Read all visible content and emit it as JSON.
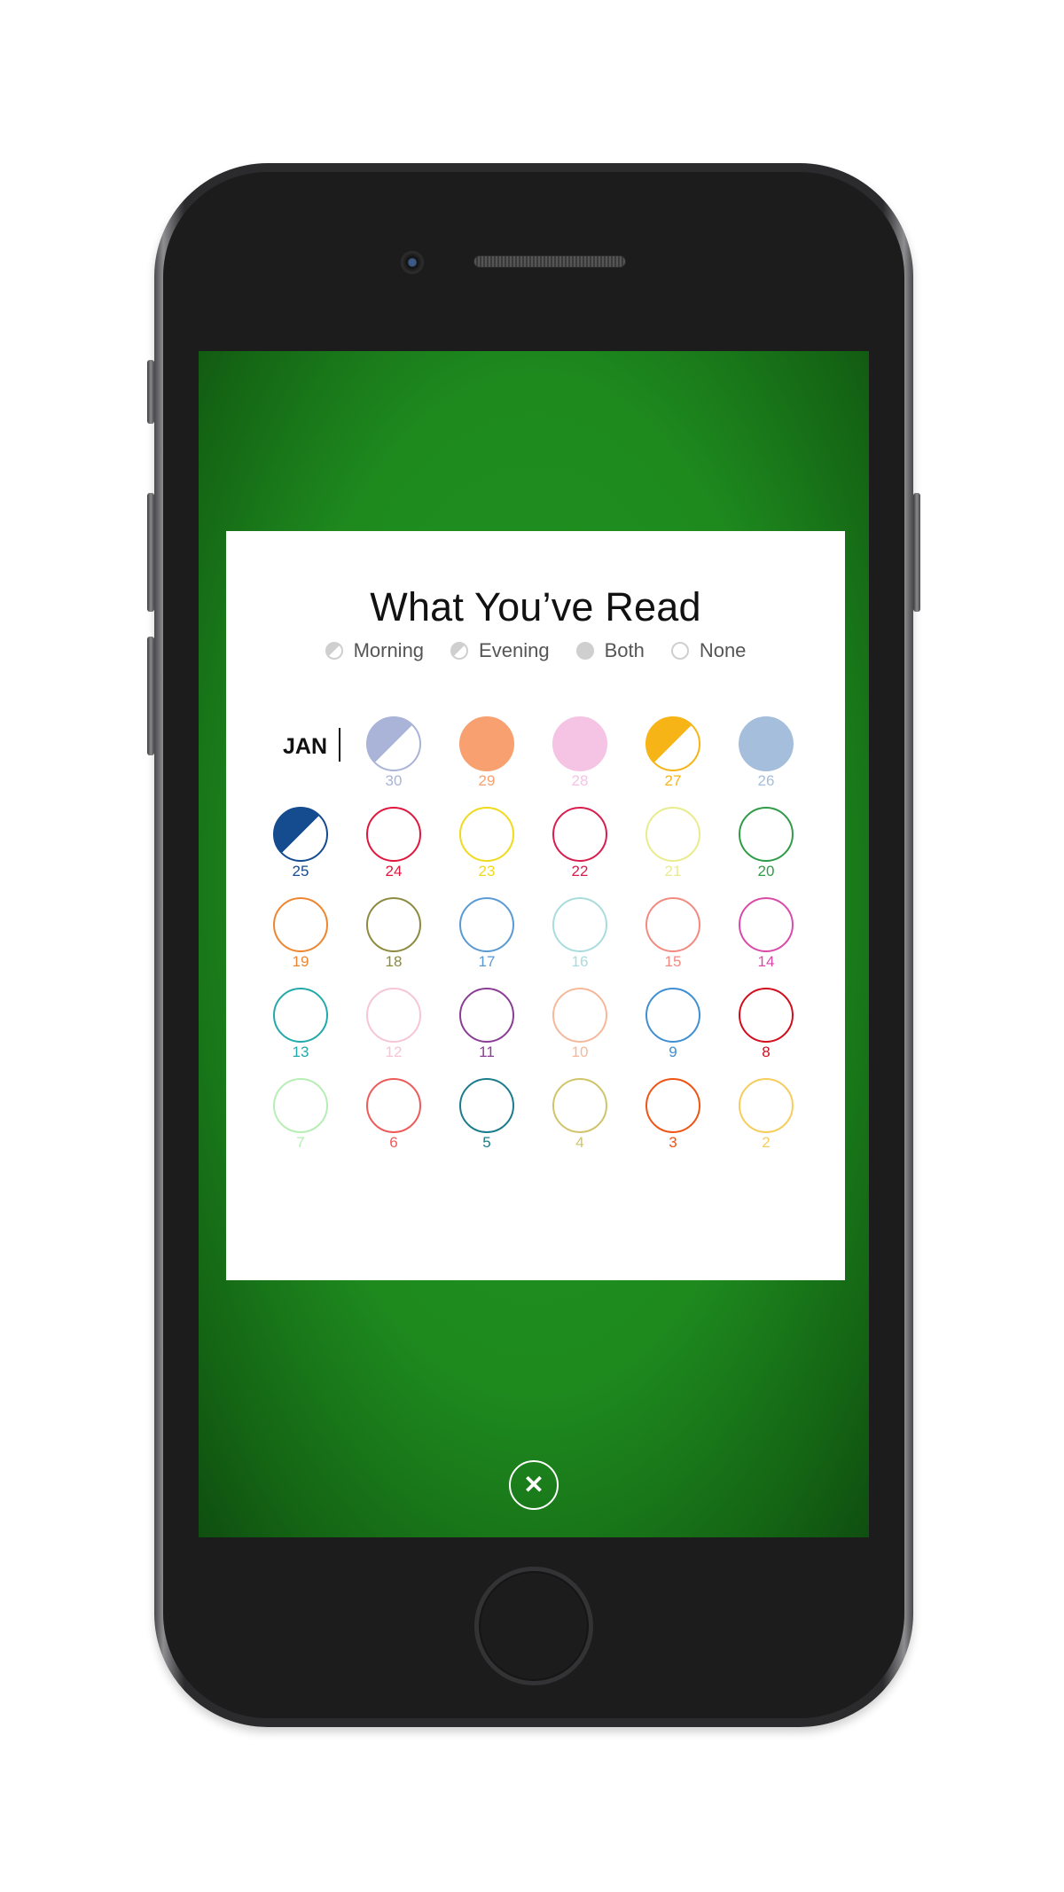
{
  "card": {
    "title": "What You’ve Read",
    "legend": [
      {
        "label": "Morning",
        "icon": "morning-half-icon"
      },
      {
        "label": "Evening",
        "icon": "evening-half-icon"
      },
      {
        "label": "Both",
        "icon": "both-filled-icon"
      },
      {
        "label": "None",
        "icon": "none-empty-icon"
      }
    ],
    "month": "JAN",
    "days": [
      {
        "num": "30",
        "color": "#aab3d8",
        "read": "morning"
      },
      {
        "num": "29",
        "color": "#f8a070",
        "read": "both"
      },
      {
        "num": "28",
        "color": "#f5c3e4",
        "read": "both"
      },
      {
        "num": "27",
        "color": "#f6b417",
        "read": "morning"
      },
      {
        "num": "26",
        "color": "#a5bedc",
        "read": "both"
      },
      {
        "num": "25",
        "color": "#154c8f",
        "read": "morning"
      },
      {
        "num": "24",
        "color": "#e0163d",
        "read": "none"
      },
      {
        "num": "23",
        "color": "#f0da1c",
        "read": "none"
      },
      {
        "num": "22",
        "color": "#d81c4e",
        "read": "none"
      },
      {
        "num": "21",
        "color": "#e8ec8c",
        "read": "none"
      },
      {
        "num": "20",
        "color": "#2f9b47",
        "read": "none"
      },
      {
        "num": "19",
        "color": "#ee8630",
        "read": "none"
      },
      {
        "num": "18",
        "color": "#8c8a3e",
        "read": "none"
      },
      {
        "num": "17",
        "color": "#5a9ad4",
        "read": "none"
      },
      {
        "num": "16",
        "color": "#a9dcdc",
        "read": "none"
      },
      {
        "num": "15",
        "color": "#f28a80",
        "read": "none"
      },
      {
        "num": "14",
        "color": "#d94aa8",
        "read": "none"
      },
      {
        "num": "13",
        "color": "#23a9a9",
        "read": "none"
      },
      {
        "num": "12",
        "color": "#f6c6d4",
        "read": "none"
      },
      {
        "num": "11",
        "color": "#8a3d94",
        "read": "none"
      },
      {
        "num": "10",
        "color": "#f6b89a",
        "read": "none"
      },
      {
        "num": "9",
        "color": "#3f8fd2",
        "read": "none"
      },
      {
        "num": "8",
        "color": "#d10c1c",
        "read": "none"
      },
      {
        "num": "7",
        "color": "#b6eeb4",
        "read": "none"
      },
      {
        "num": "6",
        "color": "#ee5a5a",
        "read": "none"
      },
      {
        "num": "5",
        "color": "#1a7c8c",
        "read": "none"
      },
      {
        "num": "4",
        "color": "#d0c46a",
        "read": "none"
      },
      {
        "num": "3",
        "color": "#f05414",
        "read": "none"
      },
      {
        "num": "2",
        "color": "#f6cc5c",
        "read": "none"
      }
    ]
  },
  "close_icon": "close-icon",
  "close_symbol": "✕"
}
